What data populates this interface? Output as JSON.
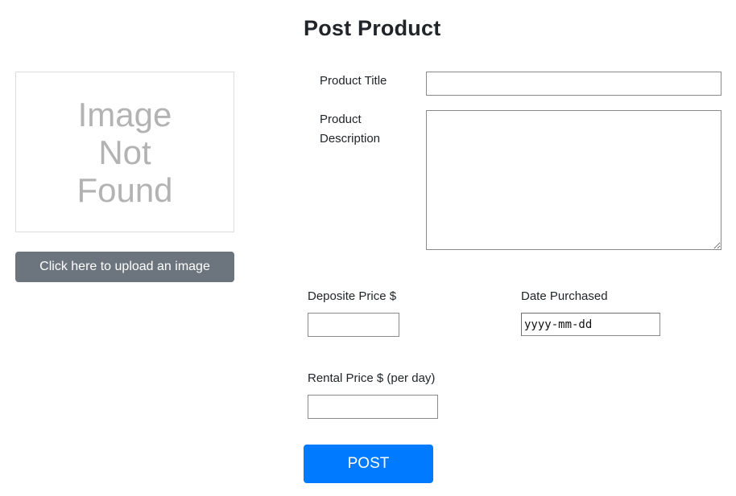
{
  "page": {
    "title": "Post Product"
  },
  "image_panel": {
    "placeholder_text": "Image\nNot\nFound",
    "upload_label": "Click here to upload an image"
  },
  "form": {
    "product_title": {
      "label": "Product Title",
      "value": ""
    },
    "product_description": {
      "label": "Product\nDescription",
      "value": ""
    },
    "deposit_price": {
      "label": "Deposite Price $",
      "value": ""
    },
    "date_purchased": {
      "label": "Date Purchased",
      "placeholder": "yyyy-mm-dd"
    },
    "rental_price": {
      "label": "Rental Price $ (per day)",
      "value": ""
    },
    "submit_label": "POST"
  },
  "colors": {
    "primary": "#007bff",
    "secondary": "#6c757d",
    "placeholder_gray": "#b3b3b3"
  }
}
